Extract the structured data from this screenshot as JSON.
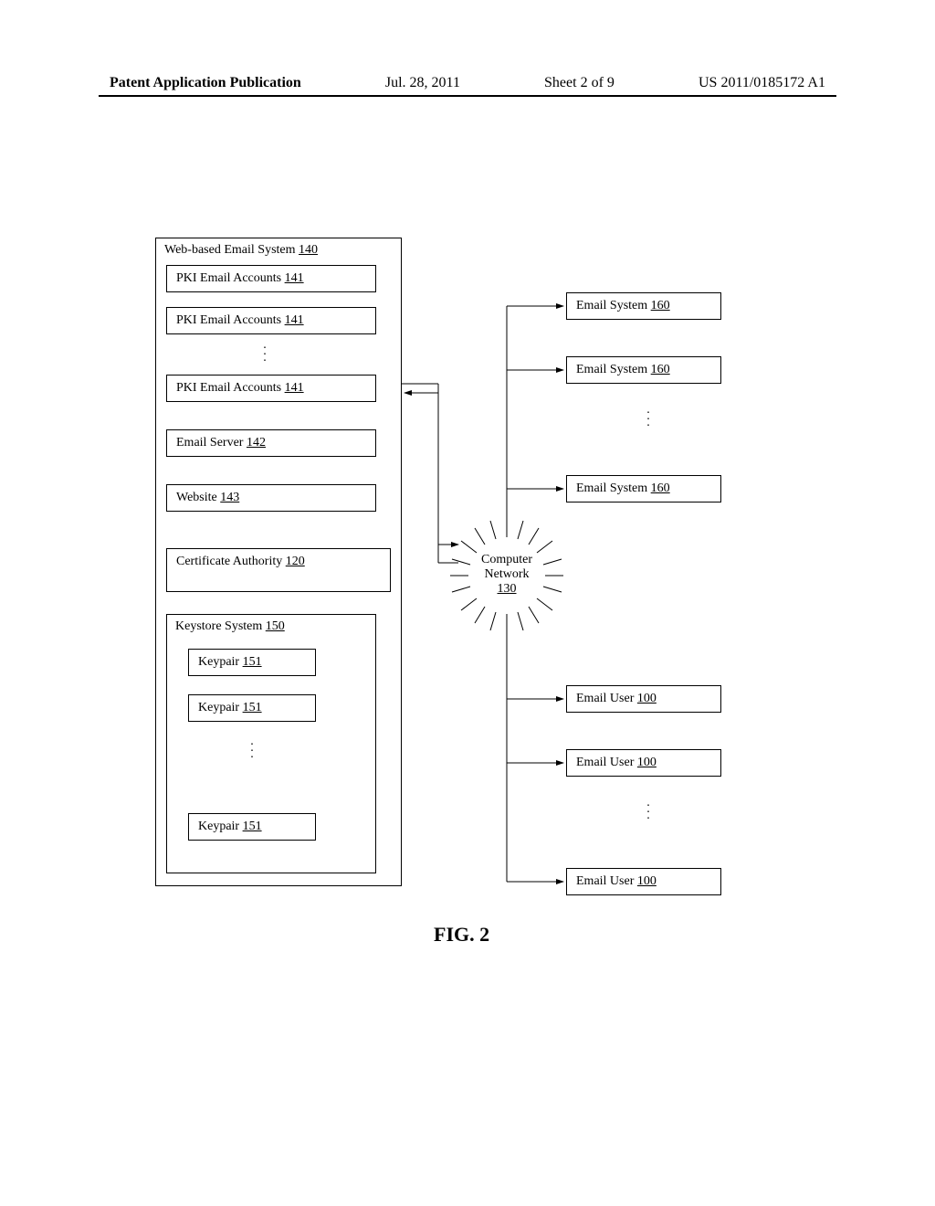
{
  "header": {
    "publication": "Patent Application Publication",
    "date": "Jul. 28, 2011",
    "sheet": "Sheet 2 of 9",
    "docnum": "US 2011/0185172 A1"
  },
  "webSystem": {
    "title_text": "Web-based Email System ",
    "title_num": "140",
    "pki_text": "PKI Email Accounts ",
    "pki_num": "141",
    "emailServer_text": "Email Server ",
    "emailServer_num": "142",
    "website_text": "Website ",
    "website_num": "143",
    "ca_text": "Certificate Authority ",
    "ca_num": "120",
    "keystore_text": "Keystore System ",
    "keystore_num": "150",
    "keypair_text": "Keypair ",
    "keypair_num": "151"
  },
  "network": {
    "label_l1": "Computer",
    "label_l2": "Network",
    "label_num": "130"
  },
  "emailSystem": {
    "text": "Email System ",
    "num": "160"
  },
  "emailUser": {
    "text": "Email User ",
    "num": "100"
  },
  "figure": {
    "caption": "FIG. 2"
  }
}
